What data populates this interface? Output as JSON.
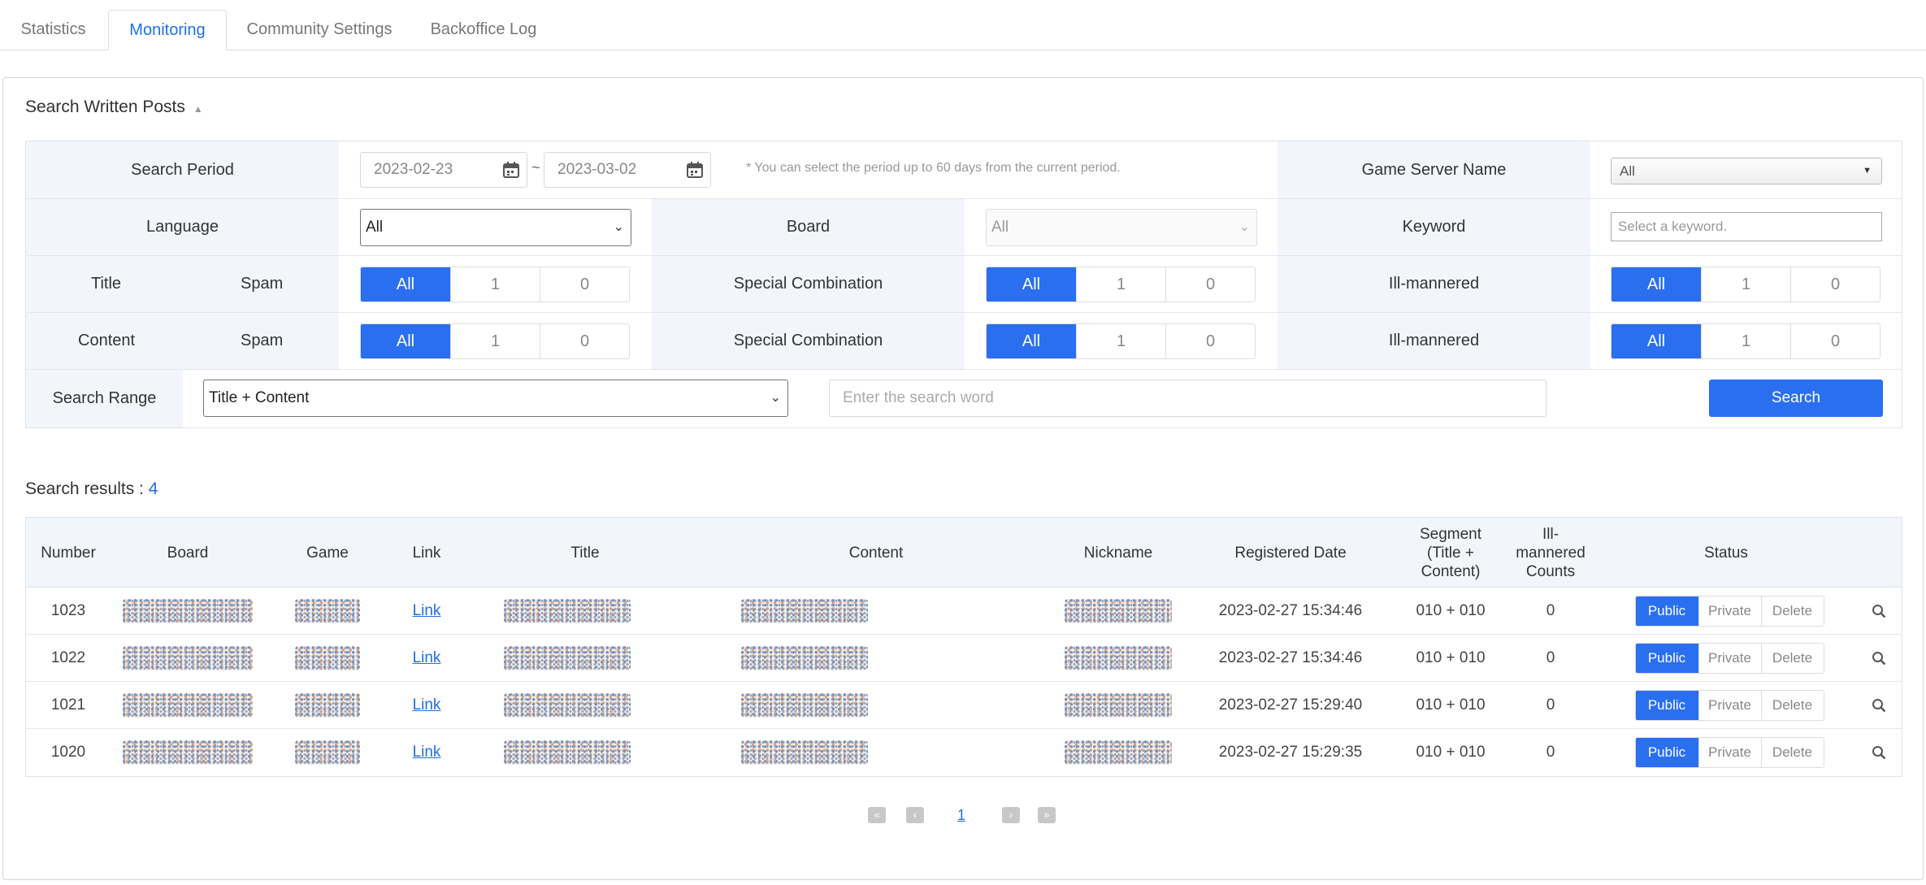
{
  "tabs": [
    "Statistics",
    "Monitoring",
    "Community Settings",
    "Backoffice Log"
  ],
  "section_title": "Search Written Posts",
  "filters": {
    "search_period_label": "Search Period",
    "date_from": "2023-02-23",
    "date_to": "2023-03-02",
    "tilde": "~",
    "period_note": "* You can select the period up to 60 days from the current period.",
    "game_server_label": "Game Server Name",
    "game_server_value": "All",
    "language_label": "Language",
    "language_value": "All",
    "board_label": "Board",
    "board_value": "All",
    "keyword_label": "Keyword",
    "keyword_placeholder": "Select a keyword.",
    "title_label": "Title",
    "content_label": "Content",
    "spam_label": "Spam",
    "special_combination_label": "Special Combination",
    "ill_mannered_label": "Ill-mannered",
    "toggle_options": [
      "All",
      "1",
      "0"
    ],
    "search_range_label": "Search Range",
    "search_range_value": "Title + Content",
    "search_word_placeholder": "Enter the search word",
    "search_button": "Search"
  },
  "results": {
    "label": "Search results : ",
    "count": "4",
    "columns": {
      "number": "Number",
      "board": "Board",
      "game": "Game",
      "link": "Link",
      "title": "Title",
      "content": "Content",
      "nickname": "Nickname",
      "registered_date": "Registered Date",
      "segment": "Segment (Title + Content)",
      "ill_mannered_counts": "Ill-mannered Counts",
      "status": "Status"
    },
    "status_options": [
      "Public",
      "Private",
      "Delete"
    ],
    "rows": [
      {
        "number": "1023",
        "link": "Link",
        "registered": "2023-02-27 15:34:46",
        "segment": "010 + 010",
        "ill": "0",
        "status": "Public"
      },
      {
        "number": "1022",
        "link": "Link",
        "registered": "2023-02-27 15:34:46",
        "segment": "010 + 010",
        "ill": "0",
        "status": "Public"
      },
      {
        "number": "1021",
        "link": "Link",
        "registered": "2023-02-27 15:29:40",
        "segment": "010 + 010",
        "ill": "0",
        "status": "Public"
      },
      {
        "number": "1020",
        "link": "Link",
        "registered": "2023-02-27 15:29:35",
        "segment": "010 + 010",
        "ill": "0",
        "status": "Public"
      }
    ]
  },
  "pagination": {
    "current_page": "1"
  },
  "colors": {
    "accent": "#2a6ff0",
    "label_bg": "#f2f5fa"
  }
}
